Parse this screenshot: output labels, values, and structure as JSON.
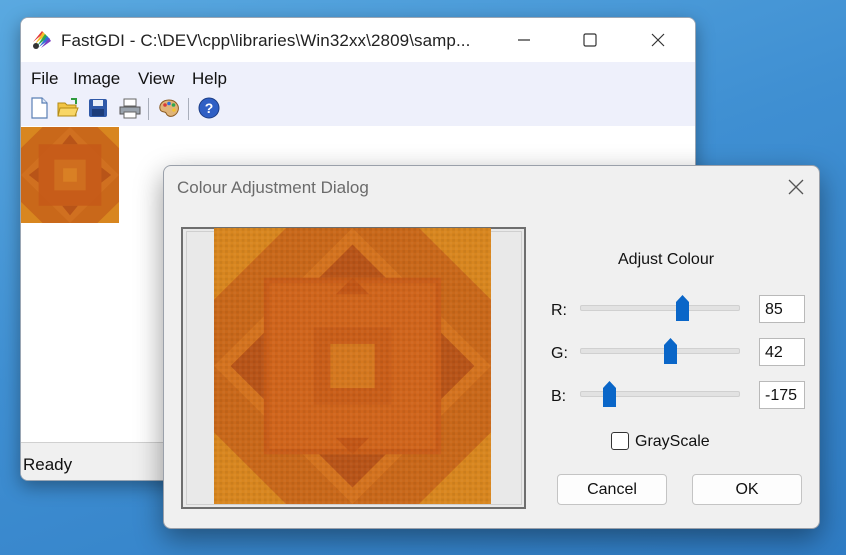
{
  "main_window": {
    "title": "FastGDI - C:\\DEV\\cpp\\libraries\\Win32xx\\2809\\samp...",
    "menu": [
      {
        "label": "File"
      },
      {
        "label": "Image"
      },
      {
        "label": "View"
      },
      {
        "label": "Help"
      }
    ],
    "toolbar": [
      {
        "icon": "new-file-icon"
      },
      {
        "icon": "open-folder-icon"
      },
      {
        "icon": "save-disk-icon"
      },
      {
        "icon": "printer-icon"
      },
      {
        "icon": "palette-icon"
      },
      {
        "icon": "help-icon"
      }
    ],
    "status": "Ready"
  },
  "dialog": {
    "title": "Colour Adjustment Dialog",
    "heading": "Adjust Colour",
    "channels": [
      {
        "label": "R:",
        "value": "85",
        "level": 85
      },
      {
        "label": "G:",
        "value": "42",
        "level": 42
      },
      {
        "label": "B:",
        "value": "-175",
        "level": -175
      }
    ],
    "slider_range": [
      -255,
      255
    ],
    "grayscale_label": "GrayScale",
    "grayscale_checked": false,
    "cancel_label": "Cancel",
    "ok_label": "OK"
  },
  "colors": {
    "accent": "#0a66c8",
    "image_base": "#c9681a",
    "image_light": "#d8861f",
    "image_dark": "#b85418"
  }
}
